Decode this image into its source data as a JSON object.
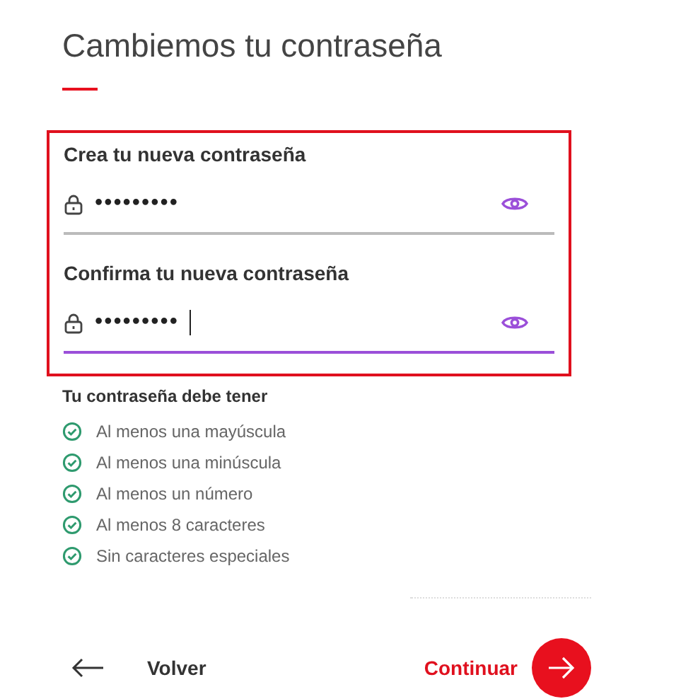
{
  "title": "Cambiemos tu contraseña",
  "fields": [
    {
      "label": "Crea tu nueva contraseña",
      "value": "•••••••••",
      "focused": false
    },
    {
      "label": "Confirma tu nueva contraseña",
      "value": "•••••••••",
      "focused": true
    }
  ],
  "requirements": {
    "heading": "Tu contraseña debe tener",
    "items": [
      {
        "text": "Al menos una mayúscula",
        "met": true
      },
      {
        "text": "Al menos una minúscula",
        "met": true
      },
      {
        "text": "Al menos un número",
        "met": true
      },
      {
        "text": "Al menos 8 caracteres",
        "met": true
      },
      {
        "text": "Sin caracteres especiales",
        "met": true
      }
    ]
  },
  "back": {
    "label": "Volver"
  },
  "next": {
    "label": "Continuar"
  }
}
